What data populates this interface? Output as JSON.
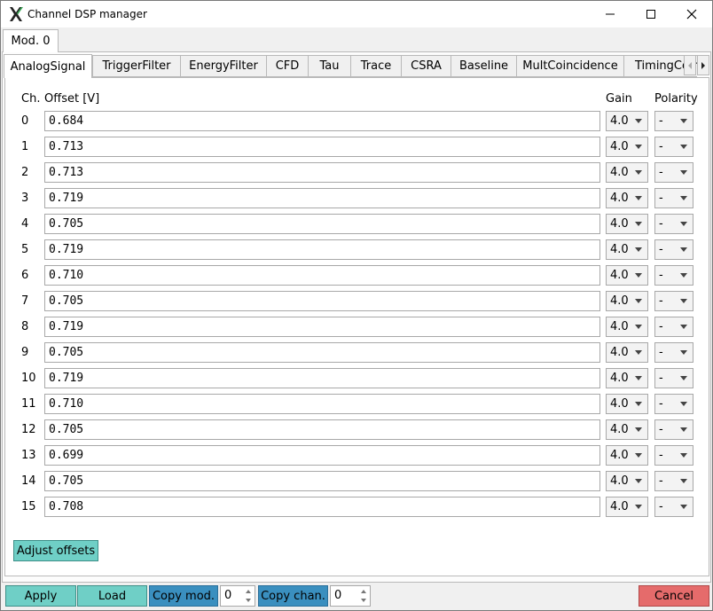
{
  "window": {
    "title": "Channel DSP manager"
  },
  "module_tabs": [
    {
      "label": "Mod. 0"
    }
  ],
  "tabs": [
    {
      "label": "AnalogSignal"
    },
    {
      "label": "TriggerFilter"
    },
    {
      "label": "EnergyFilter"
    },
    {
      "label": "CFD"
    },
    {
      "label": "Tau"
    },
    {
      "label": "Trace"
    },
    {
      "label": "CSRA"
    },
    {
      "label": "Baseline"
    },
    {
      "label": "MultCoincidence"
    },
    {
      "label": "TimingCoincidence"
    }
  ],
  "headers": {
    "channel": "Ch.",
    "offset": "Offset [V]",
    "gain": "Gain",
    "polarity": "Polarity"
  },
  "channels": [
    {
      "ch": "0",
      "offset": "0.684",
      "gain": "4.0",
      "polarity": "-"
    },
    {
      "ch": "1",
      "offset": "0.713",
      "gain": "4.0",
      "polarity": "-"
    },
    {
      "ch": "2",
      "offset": "0.713",
      "gain": "4.0",
      "polarity": "-"
    },
    {
      "ch": "3",
      "offset": "0.719",
      "gain": "4.0",
      "polarity": "-"
    },
    {
      "ch": "4",
      "offset": "0.705",
      "gain": "4.0",
      "polarity": "-"
    },
    {
      "ch": "5",
      "offset": "0.719",
      "gain": "4.0",
      "polarity": "-"
    },
    {
      "ch": "6",
      "offset": "0.710",
      "gain": "4.0",
      "polarity": "-"
    },
    {
      "ch": "7",
      "offset": "0.705",
      "gain": "4.0",
      "polarity": "-"
    },
    {
      "ch": "8",
      "offset": "0.719",
      "gain": "4.0",
      "polarity": "-"
    },
    {
      "ch": "9",
      "offset": "0.705",
      "gain": "4.0",
      "polarity": "-"
    },
    {
      "ch": "10",
      "offset": "0.719",
      "gain": "4.0",
      "polarity": "-"
    },
    {
      "ch": "11",
      "offset": "0.710",
      "gain": "4.0",
      "polarity": "-"
    },
    {
      "ch": "12",
      "offset": "0.705",
      "gain": "4.0",
      "polarity": "-"
    },
    {
      "ch": "13",
      "offset": "0.699",
      "gain": "4.0",
      "polarity": "-"
    },
    {
      "ch": "14",
      "offset": "0.705",
      "gain": "4.0",
      "polarity": "-"
    },
    {
      "ch": "15",
      "offset": "0.708",
      "gain": "4.0",
      "polarity": "-"
    }
  ],
  "buttons": {
    "adjust_offsets": "Adjust offsets",
    "apply": "Apply",
    "load": "Load",
    "copy_mod": "Copy mod.",
    "copy_mod_value": "0",
    "copy_chan": "Copy chan.",
    "copy_chan_value": "0",
    "cancel": "Cancel"
  },
  "colors": {
    "teal": "#6fcfc6",
    "blue": "#3a8fbf",
    "red": "#e56b6b"
  }
}
